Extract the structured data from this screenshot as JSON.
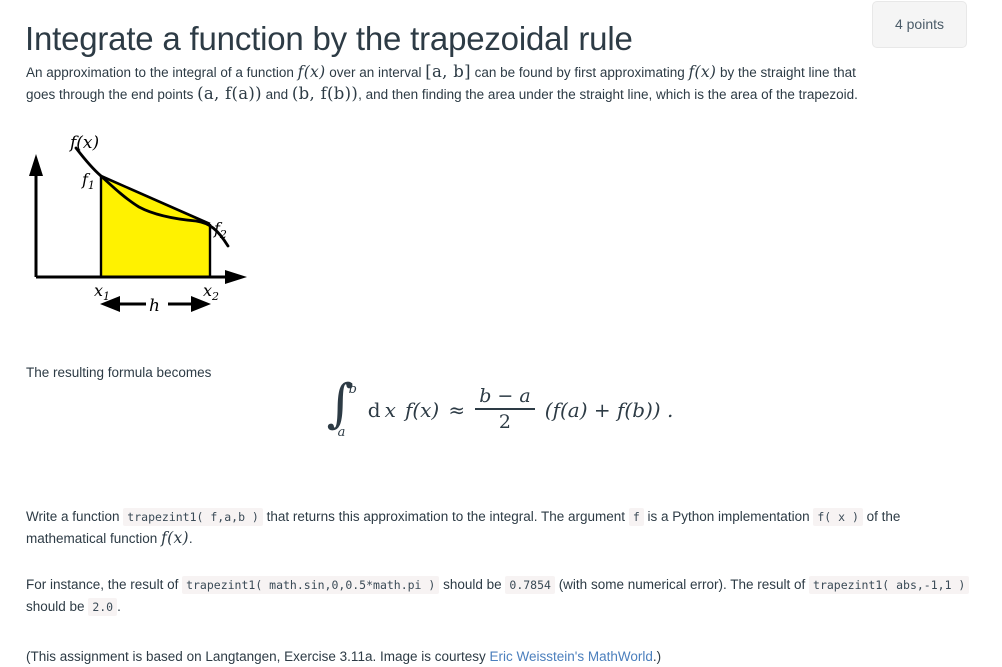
{
  "header": {
    "title": "Integrate a function by the trapezoidal rule",
    "points_badge": "4 points"
  },
  "intro": {
    "t1": "An approximation to the integral of a function ",
    "m1": "f(x)",
    "t2": " over an interval ",
    "m2": "[a, b]",
    "t3": " can be found by first approximating ",
    "m3": "f(x)",
    "t4": " by the straight line that goes through the end points ",
    "m4": "(a, f(a))",
    "t5": " and ",
    "m5": "(b, f(b))",
    "t6": ", and then finding the area under the straight line, which is the area of the trapezoid."
  },
  "figure": {
    "caption_fx": "f(x)",
    "label_f1": "f",
    "label_f1_sub": "1",
    "label_f2": "f",
    "label_f2_sub": "2",
    "label_x1": "x",
    "label_x1_sub": "1",
    "label_x2": "x",
    "label_x2_sub": "2",
    "label_h": "h",
    "fill_color": "#FFF200",
    "stroke_color": "#000000"
  },
  "resulting": {
    "text": "The resulting formula becomes"
  },
  "equation": {
    "integral_sign": "∫",
    "limit_upper": "b",
    "limit_lower": "a",
    "integrand": "dx f(x)",
    "approx": "≈",
    "frac_num": "b − a",
    "frac_den": "2",
    "tail": "(f(a) + f(b)) .",
    "dx_label": "d",
    "dx_var": "x",
    "fx_label": "f(x)"
  },
  "write": {
    "t1": "Write a function ",
    "code1": "trapezint1( f,a,b )",
    "t2": " that returns this approximation to the integral. The argument ",
    "code2": "f",
    "t3": " is a Python implementation ",
    "code3": "f( x )",
    "t4": " of the mathematical function ",
    "m1": "f(x)",
    "t5": "."
  },
  "instance": {
    "t1": "For instance, the result of ",
    "code1": "trapezint1( math.sin,0,0.5*math.pi )",
    "t2": " should be ",
    "code2": "0.7854",
    "t3": " (with some numerical error). The result of ",
    "code3": "trapezint1( abs,-1,1 )",
    "t4": " should be ",
    "code4": "2.0",
    "t5": "."
  },
  "credit": {
    "t1": "(This assignment is based on Langtangen, Exercise 3.11a. Image is courtesy ",
    "link": "Eric Weisstein's MathWorld",
    "t2": ".)",
    "link_color": "#4b7fbd"
  }
}
